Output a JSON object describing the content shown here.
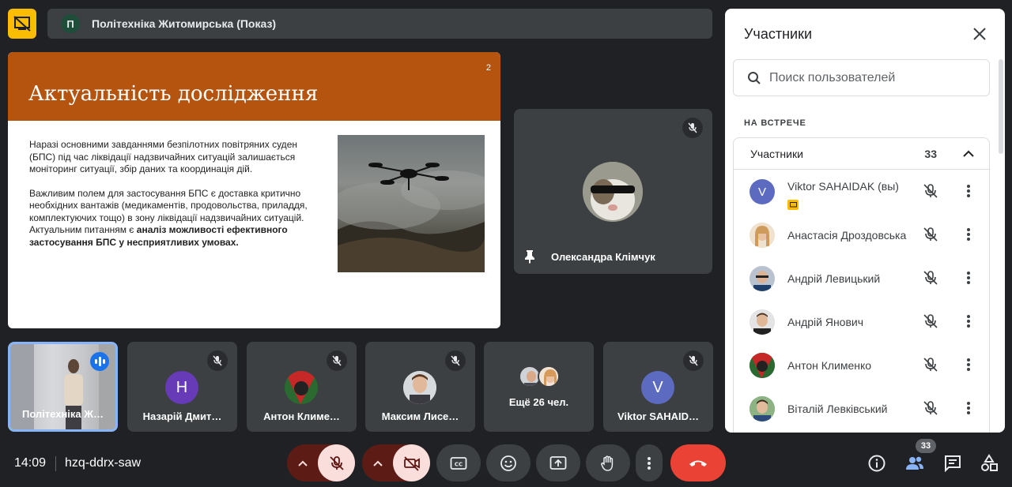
{
  "top_bar": {
    "presenter_initial": "П",
    "presenter_title": "Політехніка Житомирська (Показ)"
  },
  "slide": {
    "title": "Актуальність дослідження",
    "number": "2",
    "paragraph1": "Наразі основними завданнями безпілотних повітряних суден (БПС) під час ліквідації надзвичайних ситуацій залишається моніторинг ситуації, збір даних та координація дій.",
    "paragraph2_plain": "Важливим полем для застосування БПС є доставка критично необхідних вантажів (медикаментів, продовольства, приладдя, комплектуючих тощо) в зону ліквідації надзвичайних ситуацій. Актуальним питанням є ",
    "paragraph2_bold": "аналіз можливості ефективного застосування БПС у несприятливих умовах."
  },
  "speaker": {
    "name": "Олександра Клімчук"
  },
  "tiles": [
    {
      "name": "Політехніка Ж…"
    },
    {
      "name": "Назарій Дмит…",
      "initial": "Н",
      "color": "#673ab7"
    },
    {
      "name": "Антон Климе…"
    },
    {
      "name": "Максим Лисе…"
    },
    {
      "name": "Ещё 26 чел."
    },
    {
      "name": "Viktor SAHAID…",
      "initial": "V",
      "color": "#5c6bc0"
    }
  ],
  "panel": {
    "title": "Участники",
    "search_placeholder": "Поиск пользователей",
    "section_label": "НА ВСТРЕЧЕ",
    "group_label": "Участники",
    "group_count": "33",
    "participants": [
      {
        "name": "Viktor SAHAIDAK (вы)",
        "initial": "V",
        "color": "#5c6bc0"
      },
      {
        "name": "Анастасія Дроздовська"
      },
      {
        "name": "Андрій Левицький"
      },
      {
        "name": "Андрій Янович"
      },
      {
        "name": "Антон Клименко"
      },
      {
        "name": "Віталій Левківський"
      }
    ]
  },
  "bottom_bar": {
    "time": "14:09",
    "meeting_code": "hzq-ddrx-saw",
    "participants_badge": "33"
  },
  "colors": {
    "accent": "#8ab4f8",
    "end_call": "#ea4335",
    "muted_bg": "#f9dedc",
    "present": "#fbbc04",
    "slide_header": "#b5540f"
  }
}
